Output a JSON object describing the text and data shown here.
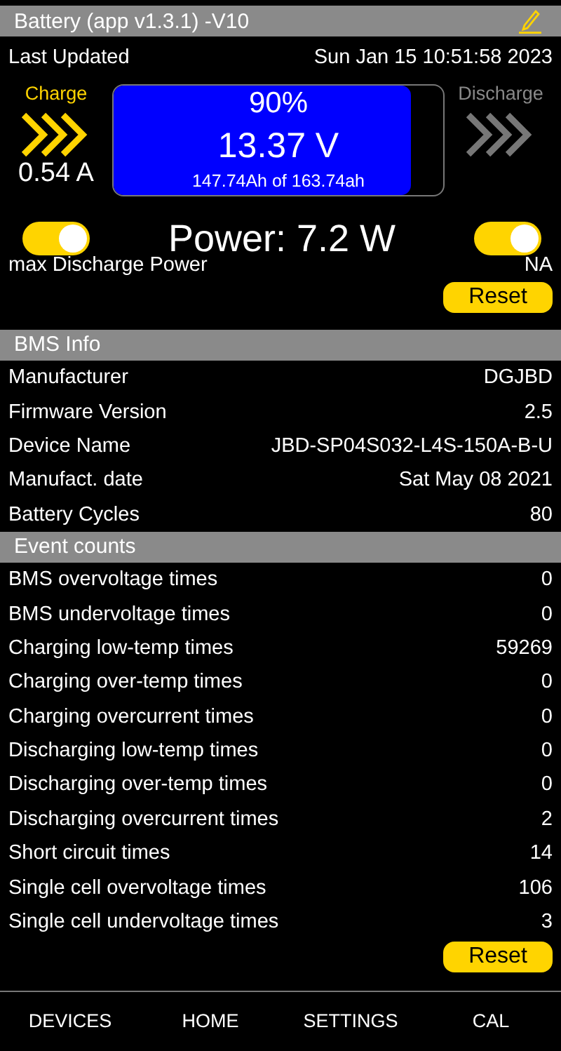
{
  "header": {
    "title": "Battery (app v1.3.1) -V10"
  },
  "last_updated": {
    "label": "Last Updated",
    "value": "Sun Jan 15 10:51:58 2023"
  },
  "charge": {
    "label": "Charge",
    "active": true,
    "current": "0.54 A"
  },
  "discharge": {
    "label": "Discharge",
    "active": false
  },
  "battery": {
    "level": 0.9,
    "percent": "90%",
    "voltage": "13.37 V",
    "capacity": "147.74Ah of 163.74ah"
  },
  "power": {
    "text": "Power: 7.2 W",
    "left_toggle_on": true,
    "right_toggle_on": true,
    "left_label": "max Discharge Power",
    "right_label": "NA",
    "reset": "Reset"
  },
  "bms_info": {
    "title": "BMS Info",
    "rows": [
      {
        "label": "Manufacturer",
        "value": "DGJBD"
      },
      {
        "label": "Firmware Version",
        "value": "2.5"
      },
      {
        "label": "Device Name",
        "value": "JBD-SP04S032-L4S-150A-B-U"
      },
      {
        "label": "Manufact. date",
        "value": "Sat May 08 2021"
      },
      {
        "label": "Battery Cycles",
        "value": "80"
      }
    ]
  },
  "event_counts": {
    "title": "Event counts",
    "rows": [
      {
        "label": "BMS overvoltage times",
        "value": "0"
      },
      {
        "label": "BMS undervoltage times",
        "value": "0"
      },
      {
        "label": "Charging low-temp times",
        "value": "59269"
      },
      {
        "label": "Charging over-temp times",
        "value": "0"
      },
      {
        "label": "Charging overcurrent times",
        "value": "0"
      },
      {
        "label": "Discharging low-temp times",
        "value": "0"
      },
      {
        "label": "Discharging over-temp times",
        "value": "0"
      },
      {
        "label": "Discharging overcurrent times",
        "value": "2"
      },
      {
        "label": "Short circuit times",
        "value": "14"
      },
      {
        "label": "Single cell overvoltage times",
        "value": "106"
      },
      {
        "label": "Single cell undervoltage times",
        "value": "3"
      }
    ],
    "reset": "Reset"
  },
  "nav": [
    {
      "label": "DEVICES"
    },
    {
      "label": "HOME"
    },
    {
      "label": "SETTINGS"
    },
    {
      "label": "CAL"
    }
  ]
}
